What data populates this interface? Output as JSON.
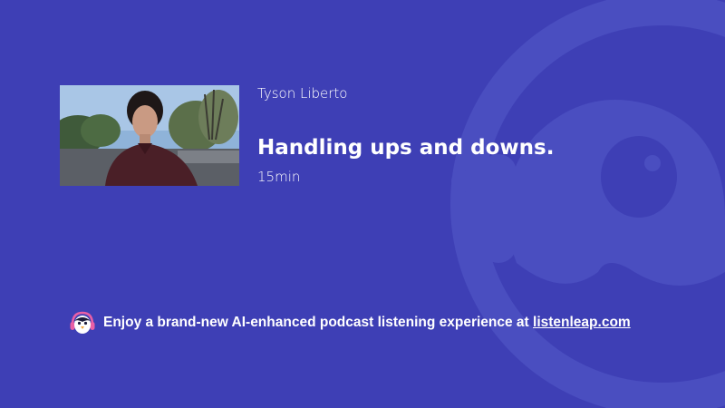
{
  "episode": {
    "author": "Tyson Liberto",
    "title": "Handling ups and downs.",
    "duration": "15min"
  },
  "footer": {
    "promo_text": "Enjoy a brand-new AI-enhanced podcast listening experience at ",
    "link_text": "listenleap.com"
  },
  "icons": {
    "logo": "penguin-headphones-icon",
    "watermark": "penguin-watermark-icon"
  },
  "colors": {
    "background": "#3e3fb5",
    "watermark": "#4b4fc0",
    "text": "#ffffff"
  }
}
